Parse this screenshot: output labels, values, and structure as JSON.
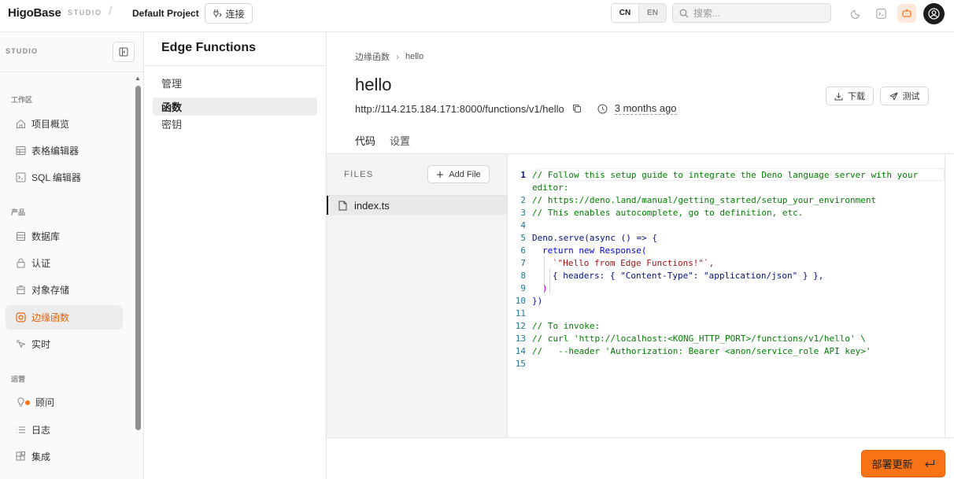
{
  "topbar": {
    "logo_text": "HigoBase",
    "logo_sub": "STUDIO",
    "separator": "/",
    "project_name": "Default Project",
    "connect_label": "连接",
    "lang_options": [
      "CN",
      "EN"
    ],
    "lang_selected": "CN",
    "search_placeholder": "搜索..."
  },
  "sidebar": {
    "header": "STUDIO",
    "groups": [
      {
        "label": "工作区",
        "items": [
          {
            "label": "项目概览",
            "icon": "home-icon"
          },
          {
            "label": "表格编辑器",
            "icon": "table-icon"
          },
          {
            "label": "SQL 编辑器",
            "icon": "terminal-icon"
          }
        ]
      },
      {
        "label": "产品",
        "items": [
          {
            "label": "数据库",
            "icon": "database-icon"
          },
          {
            "label": "认证",
            "icon": "lock-icon"
          },
          {
            "label": "对象存储",
            "icon": "storage-icon"
          },
          {
            "label": "边缘函数",
            "icon": "functions-icon",
            "active": true
          },
          {
            "label": "实时",
            "icon": "cursor-icon"
          }
        ]
      },
      {
        "label": "运营",
        "items": [
          {
            "label": "顾问",
            "icon": "lightbulb-icon"
          },
          {
            "label": "日志",
            "icon": "list-icon"
          },
          {
            "label": "集成",
            "icon": "blocks-icon"
          }
        ]
      }
    ]
  },
  "subnav": {
    "title": "Edge Functions",
    "items": [
      "管理",
      "函数",
      "密钥"
    ],
    "active": "函数"
  },
  "main": {
    "breadcrumb": [
      "边缘函数",
      "hello"
    ],
    "title": "hello",
    "url": "http://114.215.184.171:8000/functions/v1/hello",
    "updated": "3 months ago",
    "download_label": "下载",
    "test_label": "测试",
    "tabs": [
      "代码",
      "设置"
    ],
    "active_tab": "代码",
    "files_label": "FILES",
    "add_file_label": "Add File",
    "files": [
      "index.ts"
    ],
    "deploy_label": "部署更新"
  },
  "code": {
    "line_numbers": [
      "1",
      "",
      "2",
      "3",
      "4",
      "5",
      "6",
      "7",
      "8",
      "9",
      "10",
      "11",
      "12",
      "13",
      "14",
      "15"
    ],
    "lines": [
      "// Follow this setup guide to integrate the Deno language server with your",
      "editor:",
      "// https://deno.land/manual/getting_started/setup_your_environment",
      "// This enables autocomplete, go to definition, etc.",
      "",
      "Deno.serve(async () => {",
      "return new Response(",
      "`\"Hello from Edge Functions!\"`,",
      "{ headers: { \"Content-Type\": \"application/json\" } },",
      ")",
      "})",
      "",
      "// To invoke:",
      "// curl 'http://localhost:<KONG_HTTP_PORT>/functions/v1/hello' \\",
      "//   --header 'Authorization: Bearer <anon/service_role API key>'",
      ""
    ]
  },
  "colors": {
    "accent": "#f97316",
    "active_text": "#e8630a"
  }
}
